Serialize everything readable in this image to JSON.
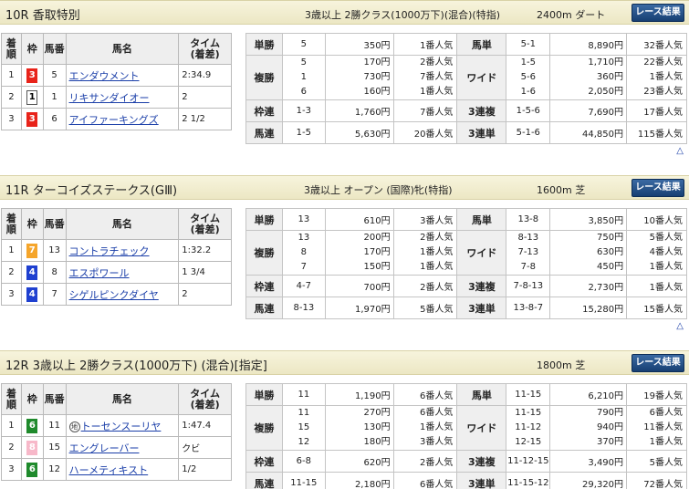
{
  "button_label": "レース結果",
  "top_arrow": "△",
  "columns": {
    "rank": "着順",
    "frame": "枠",
    "num": "馬番",
    "name": "馬名",
    "time": "タイム\n(着差)"
  },
  "races": [
    {
      "title": "10R 香取特別",
      "conditions": "3歳以上 2勝クラス(1000万下)(混合)(特指)",
      "distance": "2400m ダート",
      "horses": [
        {
          "rank": "1",
          "frame": "3",
          "num": "5",
          "name": "エンダウメント",
          "time": "2:34.9",
          "mark": ""
        },
        {
          "rank": "2",
          "frame": "1",
          "num": "1",
          "name": "リキサンダイオー",
          "time": "2",
          "mark": ""
        },
        {
          "rank": "3",
          "frame": "3",
          "num": "6",
          "name": "アイファーキングズ",
          "time": "2 1/2",
          "mark": ""
        }
      ],
      "payouts": {
        "win": {
          "label": "単勝",
          "combo": "5",
          "amount": "350円",
          "pop": "1番人気"
        },
        "place": {
          "label": "複勝",
          "rows": [
            {
              "combo": "5",
              "amount": "170円",
              "pop": "2番人気"
            },
            {
              "combo": "1",
              "amount": "730円",
              "pop": "7番人気"
            },
            {
              "combo": "6",
              "amount": "160円",
              "pop": "1番人気"
            }
          ]
        },
        "bracket": {
          "label": "枠連",
          "combo": "1-3",
          "amount": "1,760円",
          "pop": "7番人気"
        },
        "quinella": {
          "label": "馬連",
          "combo": "1-5",
          "amount": "5,630円",
          "pop": "20番人気"
        },
        "exacta": {
          "label": "馬単",
          "combo": "5-1",
          "amount": "8,890円",
          "pop": "32番人気"
        },
        "wide": {
          "label": "ワイド",
          "rows": [
            {
              "combo": "1-5",
              "amount": "1,710円",
              "pop": "22番人気"
            },
            {
              "combo": "5-6",
              "amount": "360円",
              "pop": "1番人気"
            },
            {
              "combo": "1-6",
              "amount": "2,050円",
              "pop": "23番人気"
            }
          ]
        },
        "trio": {
          "label": "3連複",
          "combo": "1-5-6",
          "amount": "7,690円",
          "pop": "17番人気"
        },
        "trifecta": {
          "label": "3連単",
          "combo": "5-1-6",
          "amount": "44,850円",
          "pop": "115番人気"
        }
      }
    },
    {
      "title": "11R ターコイズステークス(GⅢ)",
      "conditions": "3歳以上 オープン (国際)牝(特指)",
      "distance": "1600m 芝",
      "horses": [
        {
          "rank": "1",
          "frame": "7",
          "num": "13",
          "name": "コントラチェック",
          "time": "1:32.2",
          "mark": ""
        },
        {
          "rank": "2",
          "frame": "4",
          "num": "8",
          "name": "エスポワール",
          "time": "1 3/4",
          "mark": ""
        },
        {
          "rank": "3",
          "frame": "4",
          "num": "7",
          "name": "シゲルピンクダイヤ",
          "time": "2",
          "mark": ""
        }
      ],
      "payouts": {
        "win": {
          "label": "単勝",
          "combo": "13",
          "amount": "610円",
          "pop": "3番人気"
        },
        "place": {
          "label": "複勝",
          "rows": [
            {
              "combo": "13",
              "amount": "200円",
              "pop": "2番人気"
            },
            {
              "combo": "8",
              "amount": "170円",
              "pop": "1番人気"
            },
            {
              "combo": "7",
              "amount": "150円",
              "pop": "1番人気"
            }
          ]
        },
        "bracket": {
          "label": "枠連",
          "combo": "4-7",
          "amount": "700円",
          "pop": "2番人気"
        },
        "quinella": {
          "label": "馬連",
          "combo": "8-13",
          "amount": "1,970円",
          "pop": "5番人気"
        },
        "exacta": {
          "label": "馬単",
          "combo": "13-8",
          "amount": "3,850円",
          "pop": "10番人気"
        },
        "wide": {
          "label": "ワイド",
          "rows": [
            {
              "combo": "8-13",
              "amount": "750円",
              "pop": "5番人気"
            },
            {
              "combo": "7-13",
              "amount": "630円",
              "pop": "4番人気"
            },
            {
              "combo": "7-8",
              "amount": "450円",
              "pop": "1番人気"
            }
          ]
        },
        "trio": {
          "label": "3連複",
          "combo": "7-8-13",
          "amount": "2,730円",
          "pop": "1番人気"
        },
        "trifecta": {
          "label": "3連単",
          "combo": "13-8-7",
          "amount": "15,280円",
          "pop": "15番人気"
        }
      }
    },
    {
      "title": "12R 3歳以上 2勝クラス(1000万下) (混合)[指定]",
      "conditions": "",
      "distance": "1800m 芝",
      "horses": [
        {
          "rank": "1",
          "frame": "6",
          "num": "11",
          "name": "トーセンスーリヤ",
          "time": "1:47.4",
          "mark": "地"
        },
        {
          "rank": "2",
          "frame": "8",
          "num": "15",
          "name": "エングレーバー",
          "time": "クビ",
          "mark": ""
        },
        {
          "rank": "3",
          "frame": "6",
          "num": "12",
          "name": "ハーメティキスト",
          "time": "1/2",
          "mark": ""
        }
      ],
      "payouts": {
        "win": {
          "label": "単勝",
          "combo": "11",
          "amount": "1,190円",
          "pop": "6番人気"
        },
        "place": {
          "label": "複勝",
          "rows": [
            {
              "combo": "11",
              "amount": "270円",
              "pop": "6番人気"
            },
            {
              "combo": "15",
              "amount": "130円",
              "pop": "1番人気"
            },
            {
              "combo": "12",
              "amount": "180円",
              "pop": "3番人気"
            }
          ]
        },
        "bracket": {
          "label": "枠連",
          "combo": "6-8",
          "amount": "620円",
          "pop": "2番人気"
        },
        "quinella": {
          "label": "馬連",
          "combo": "11-15",
          "amount": "2,180円",
          "pop": "6番人気"
        },
        "exacta": {
          "label": "馬単",
          "combo": "11-15",
          "amount": "6,210円",
          "pop": "19番人気"
        },
        "wide": {
          "label": "ワイド",
          "rows": [
            {
              "combo": "11-15",
              "amount": "790円",
              "pop": "6番人気"
            },
            {
              "combo": "11-12",
              "amount": "940円",
              "pop": "11番人気"
            },
            {
              "combo": "12-15",
              "amount": "370円",
              "pop": "1番人気"
            }
          ]
        },
        "trio": {
          "label": "3連複",
          "combo": "11-12-15",
          "amount": "3,490円",
          "pop": "5番人気"
        },
        "trifecta": {
          "label": "3連単",
          "combo": "11-15-12",
          "amount": "29,320円",
          "pop": "72番人気"
        }
      }
    }
  ]
}
